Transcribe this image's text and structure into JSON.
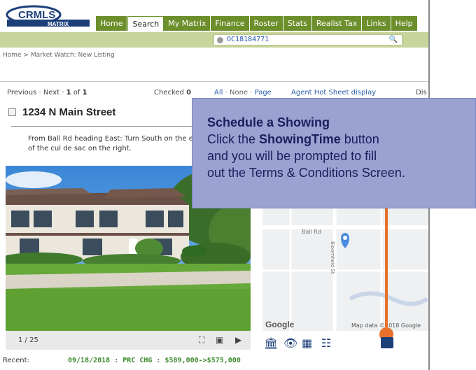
{
  "nav": {
    "items": [
      "Home",
      "Search",
      "My Matrix",
      "Finance",
      "Roster",
      "Stats",
      "Realist Tax",
      "Links",
      "Help"
    ],
    "active": "Search"
  },
  "logo": {
    "brand": "CRMLS",
    "product": "MATRIX"
  },
  "search": {
    "value": "OC18184771"
  },
  "breadcrumb": "Home > Market Watch: New Listing",
  "pager": {
    "prev": "Previous",
    "next": "Next",
    "current": "1",
    "of": "of",
    "total": "1",
    "checked_label": "Checked",
    "checked_count": "0",
    "all": "All",
    "none": "None",
    "page": "Page",
    "hot_sheet": "Agent Hot Sheet display",
    "display": "Dis"
  },
  "listing": {
    "address": "1234 N Main Street",
    "directions": "From Ball Rd heading East: Turn South on the end of the cul de sac on the right.",
    "photo_counter": "1 / 25",
    "recent_label": "Recent:",
    "recent_value": "09/18/2018 : PRC CHG : $589,000->$575,000"
  },
  "map": {
    "street_1": "Ball Rd",
    "street_2": "Bloomfield St",
    "brand": "Google",
    "attribution": "Map data ©2018 Google"
  },
  "callout": {
    "title": "Schedule a Showing",
    "line1_prefix": "Click the",
    "line1_bold": "ShowingTime",
    "line1_suffix": "button",
    "line2": "and you will be prompted to fill",
    "line3": "out the Terms & Conditions Screen."
  },
  "colors": {
    "nav_green": "#6c8f2c",
    "search_band": "#c7d49b",
    "callout_bg": "#9aa2d2",
    "callout_text": "#1a1f5c",
    "pointer": "#e8702a",
    "recent_green": "#3c8a2e"
  }
}
